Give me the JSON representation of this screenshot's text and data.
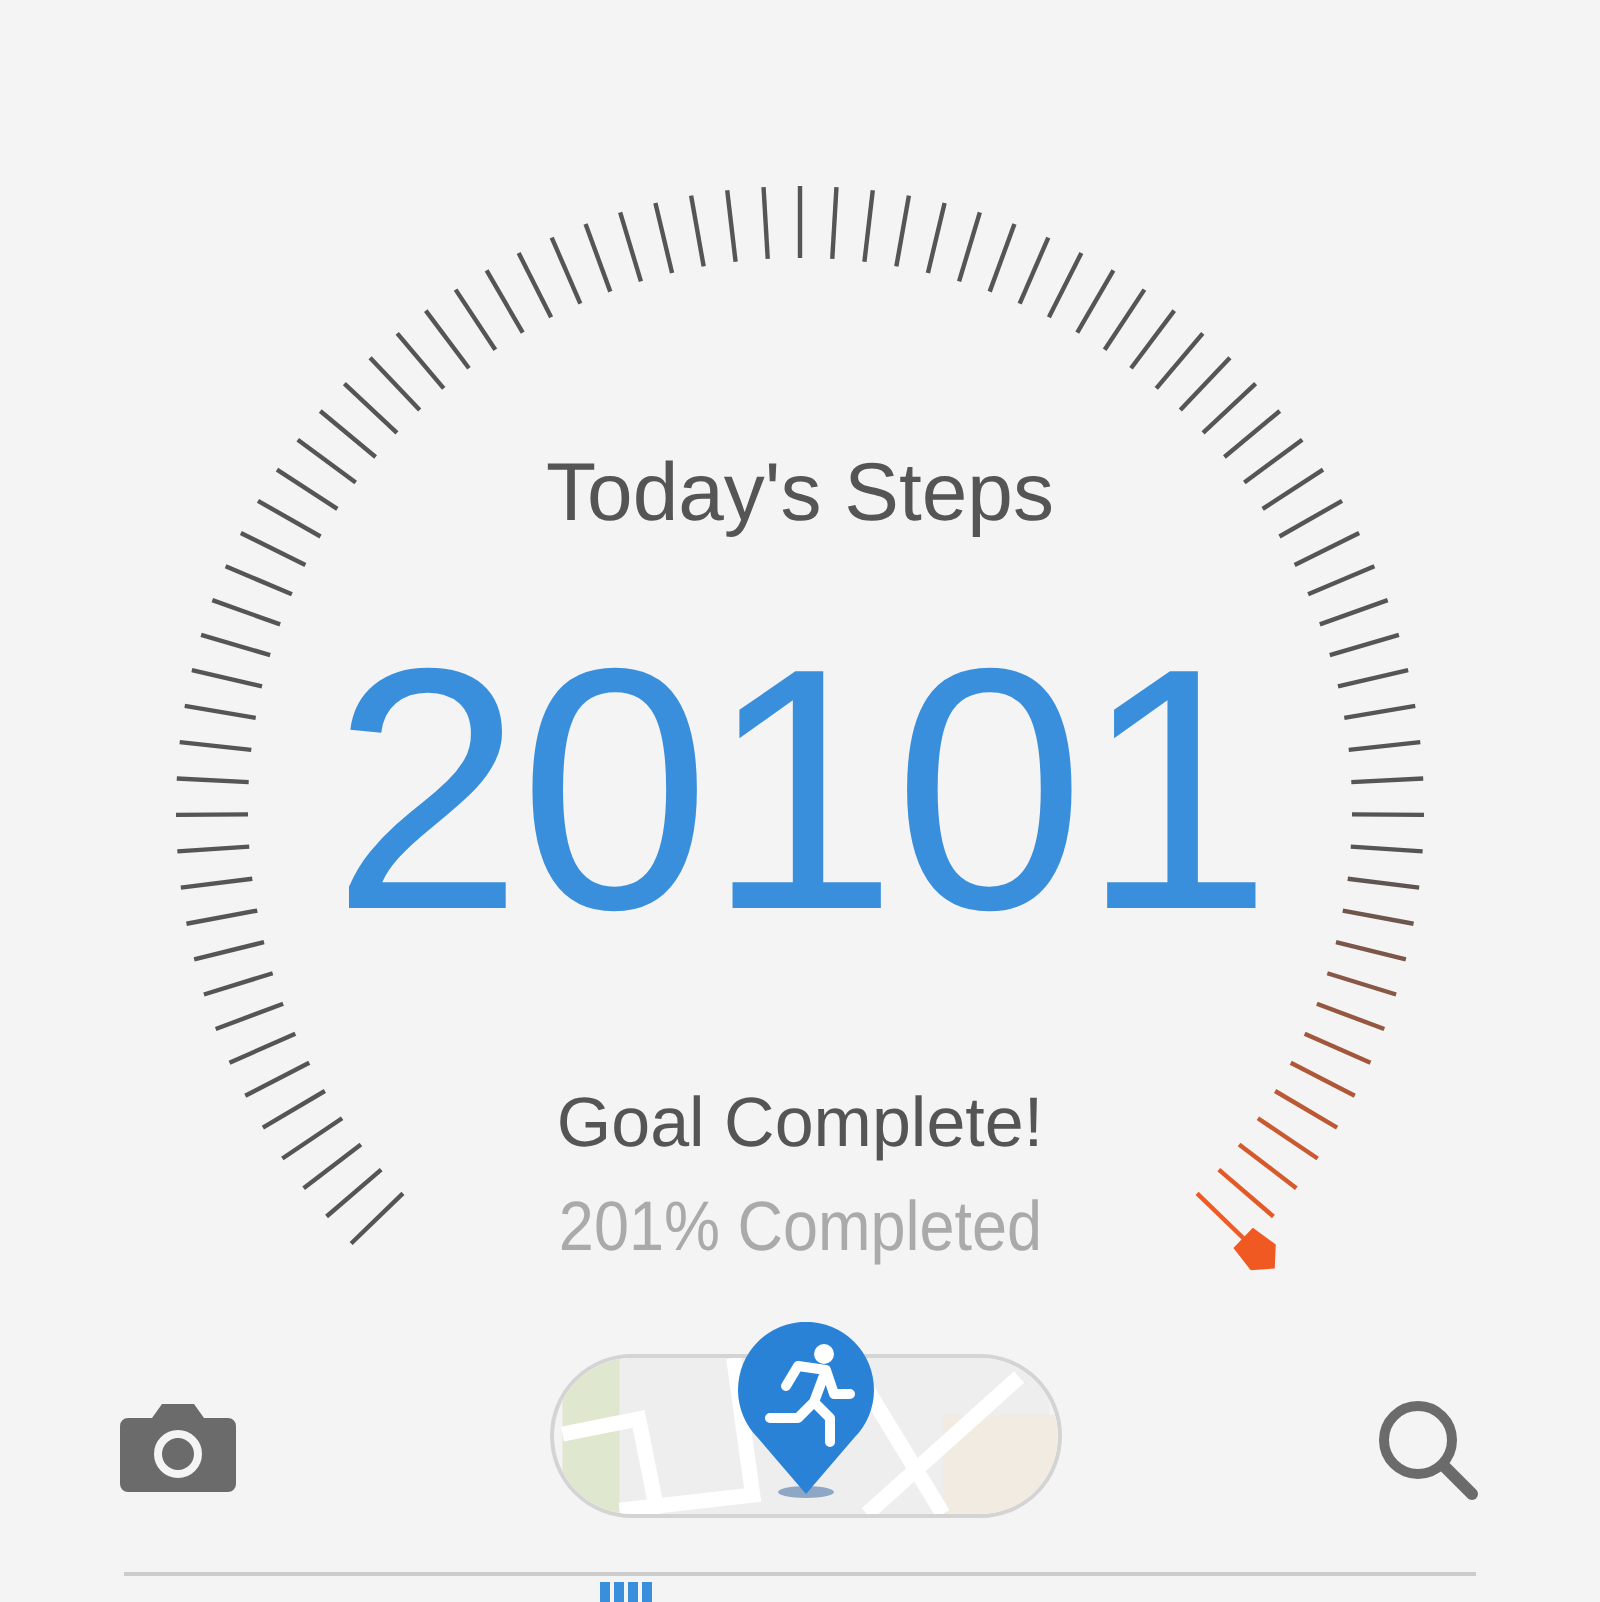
{
  "gauge": {
    "title": "Today's Steps",
    "steps": "20101",
    "status": "Goal Complete!",
    "percent": "201% Completed"
  }
}
